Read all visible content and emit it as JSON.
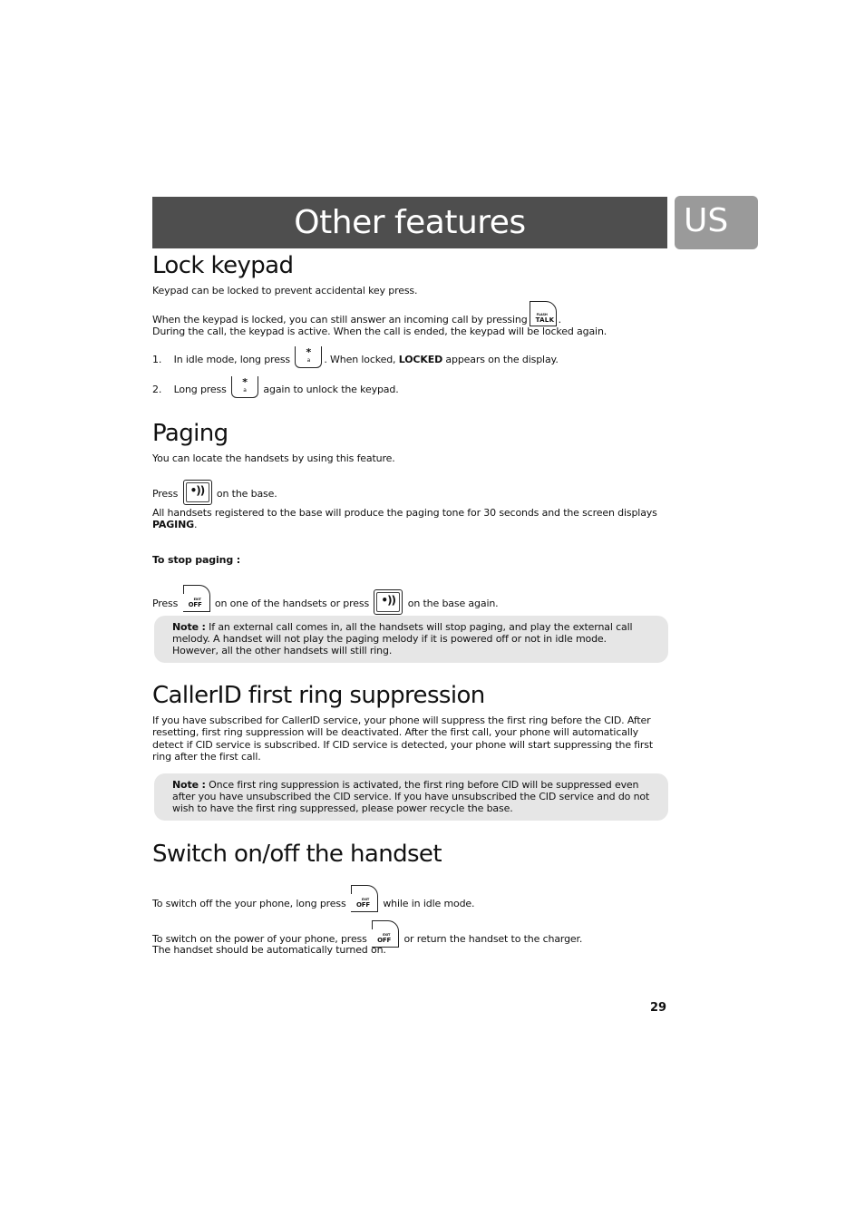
{
  "header": {
    "title": "Other features",
    "language_tab": "US"
  },
  "sections": {
    "lock_keypad": {
      "heading": "Lock keypad",
      "intro": "Keypad can be locked to prevent accidental key press.",
      "answer_text_before": "When the keypad is locked, you can still answer an incoming call by pressing",
      "answer_text_after": ".",
      "during_call": "During the call, the keypad is active. When the call is ended, the keypad will be locked again.",
      "steps": [
        {
          "num": "1.",
          "before": "In idle mode, long press",
          "after_1": ". When locked,",
          "bold": "LOCKED",
          "after_2": "appears on the display."
        },
        {
          "num": "2.",
          "before": "Long press",
          "after_1": "again to unlock the keypad."
        }
      ]
    },
    "paging": {
      "heading": "Paging",
      "intro": "You can locate the handsets by using this feature.",
      "press_label": "Press",
      "on_base": "on the base.",
      "all_handsets": "All handsets registered to the base will produce the paging tone for 30 seconds and the screen displays",
      "paging_word": "PAGING",
      "period": ".",
      "stop_heading": "To stop paging :",
      "stop_before": "Press",
      "stop_middle": "on one of the handsets or press",
      "stop_after": "on the base again.",
      "note_label": "Note :",
      "note_text": "If an external call comes in, all the handsets will stop paging, and play the external call melody. A handset will not play the paging melody if it is powered off or not in idle mode. However, all the other handsets will still ring."
    },
    "callerid": {
      "heading": "CallerID first ring suppression",
      "body": "If you have subscribed for CallerID service, your phone will suppress the first ring before the CID. After resetting, first ring suppression will be deactivated. After the first call,  your phone will automatically detect if CID service is subscribed. If CID service is detected, your phone will start suppressing the first ring after the first call.",
      "note_label": "Note :",
      "note_text": "Once first ring suppression is activated, the first ring before CID will be suppressed even after you have unsubscribed the CID service. If you have unsubscribed the CID service and do not wish to have the first ring suppressed, please power recycle the base."
    },
    "switch": {
      "heading": "Switch on/off the handset",
      "off_before": "To switch off the your phone, long press",
      "off_after": "while in idle mode.",
      "on_before": "To switch on the power of your phone, press",
      "on_after": "or return the handset to the charger.",
      "auto": "The handset should be automatically turned on."
    }
  },
  "keys": {
    "talk": {
      "icon": "talk-key-icon",
      "small": "FLASH",
      "big": "TALK"
    },
    "star": {
      "icon": "star-lock-key-icon",
      "star": "*",
      "sub": "a"
    },
    "paging": {
      "icon": "paging-key-icon",
      "glyph": "•))"
    },
    "off": {
      "icon": "off-key-icon",
      "small": "EXIT",
      "big": "OFF"
    }
  },
  "footer": {
    "page_number": "29"
  }
}
